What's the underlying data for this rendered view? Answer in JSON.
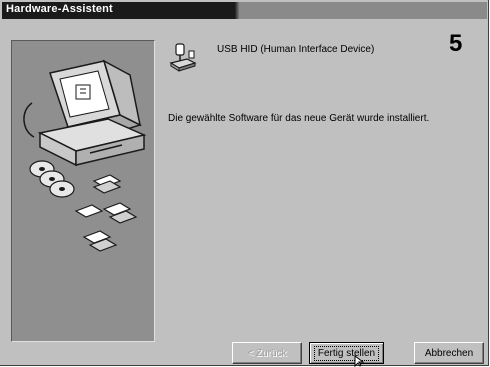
{
  "window": {
    "title": "Hardware-Assistent"
  },
  "content": {
    "device_name": "USB HID (Human Interface Device)",
    "step_number": "5",
    "status_message": "Die gewählte Software für das neue Gerät wurde installiert."
  },
  "buttons": {
    "back": {
      "label": "< Zurück",
      "enabled": false
    },
    "finish": {
      "label": "Fertig stellen",
      "default": true
    },
    "cancel": {
      "label": "Abbrechen"
    }
  }
}
